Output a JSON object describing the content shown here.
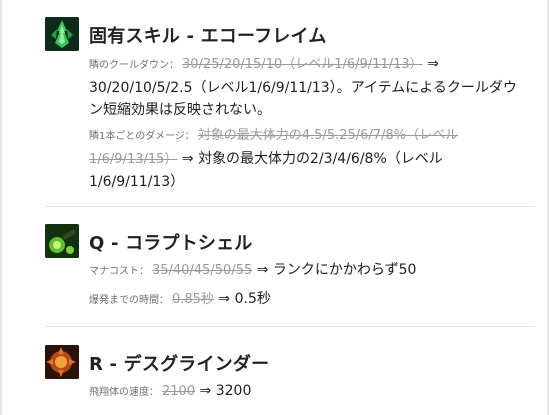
{
  "sections": [
    {
      "title": "固有スキル - エコーフレイム",
      "icon": "echo-flame-icon",
      "changes": [
        {
          "label": "隣のクールダウン：",
          "old": "30/25/20/15/10（レベル1/6/9/11/13）",
          "arrow": "⇒",
          "new": "30/20/10/5/2.5（レベル1/6/9/11/13）。アイテムによるクールダウン短縮効果は反映されない。"
        },
        {
          "label": "隣1本ごとのダメージ：",
          "old": "対象の最大体力の4.5/5.25/6/7/8%（レベル1/6/9/13/15）",
          "arrow": "⇒",
          "new": "対象の最大体力の2/3/4/6/8%（レベル1/6/9/11/13）"
        }
      ]
    },
    {
      "title": "Q - コラプトシェル",
      "icon": "corrupting-shell-icon",
      "changes": [
        {
          "label": "マナコスト：",
          "old": "35/40/45/50/55",
          "arrow": "⇒",
          "new": "ランクにかかわらず50"
        },
        {
          "label": "爆発までの時間：",
          "old": "0.85秒",
          "arrow": "⇒",
          "new": "0.5秒"
        }
      ]
    },
    {
      "title": "R - デスグラインダー",
      "icon": "death-grinder-icon",
      "changes": [
        {
          "label": "飛翔体の速度：",
          "old": "2100",
          "arrow": "⇒",
          "new": "3200"
        }
      ]
    }
  ],
  "colors": {
    "text": "#1e1e1e",
    "label": "#6f6f6f",
    "struck": "#9a9a9a",
    "divider": "#e3e3e3"
  }
}
